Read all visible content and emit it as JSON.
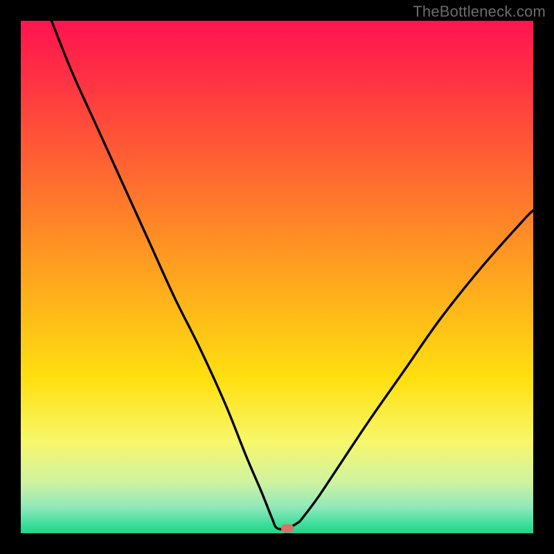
{
  "watermark": "TheBottleneck.com",
  "colors": {
    "frame": "#000000",
    "watermark": "#6c6c6c",
    "curve": "#000000",
    "marker": "#d9706a",
    "gradient_stops": [
      {
        "offset": 0.0,
        "color": "#ff1450"
      },
      {
        "offset": 0.1,
        "color": "#ff2e44"
      },
      {
        "offset": 0.25,
        "color": "#ff5a35"
      },
      {
        "offset": 0.4,
        "color": "#ff8726"
      },
      {
        "offset": 0.55,
        "color": "#ffb41a"
      },
      {
        "offset": 0.7,
        "color": "#ffe010"
      },
      {
        "offset": 0.82,
        "color": "#f7f76a"
      },
      {
        "offset": 0.9,
        "color": "#cff3a0"
      },
      {
        "offset": 0.95,
        "color": "#8fe8ba"
      },
      {
        "offset": 0.985,
        "color": "#37dd9a"
      },
      {
        "offset": 1.0,
        "color": "#1ed688"
      }
    ]
  },
  "chart_data": {
    "type": "line",
    "title": "",
    "xlabel": "",
    "ylabel": "",
    "xlim": [
      0,
      100
    ],
    "ylim": [
      0,
      100
    ],
    "grid": false,
    "legend": false,
    "series": [
      {
        "name": "bottleneck-curve",
        "x": [
          6,
          10,
          15,
          20,
          25,
          30,
          35,
          40,
          44,
          47,
          49,
          50,
          52,
          54,
          55,
          58,
          62,
          68,
          75,
          82,
          90,
          98,
          100
        ],
        "y": [
          100,
          90,
          79,
          68,
          57,
          46,
          36,
          25,
          15,
          8,
          3,
          1,
          1,
          2,
          3,
          7,
          13,
          22,
          32,
          42,
          52,
          61,
          63
        ]
      }
    ],
    "marker": {
      "x": 52,
      "y": 1
    },
    "background": "vertical-gradient-red-to-green"
  }
}
